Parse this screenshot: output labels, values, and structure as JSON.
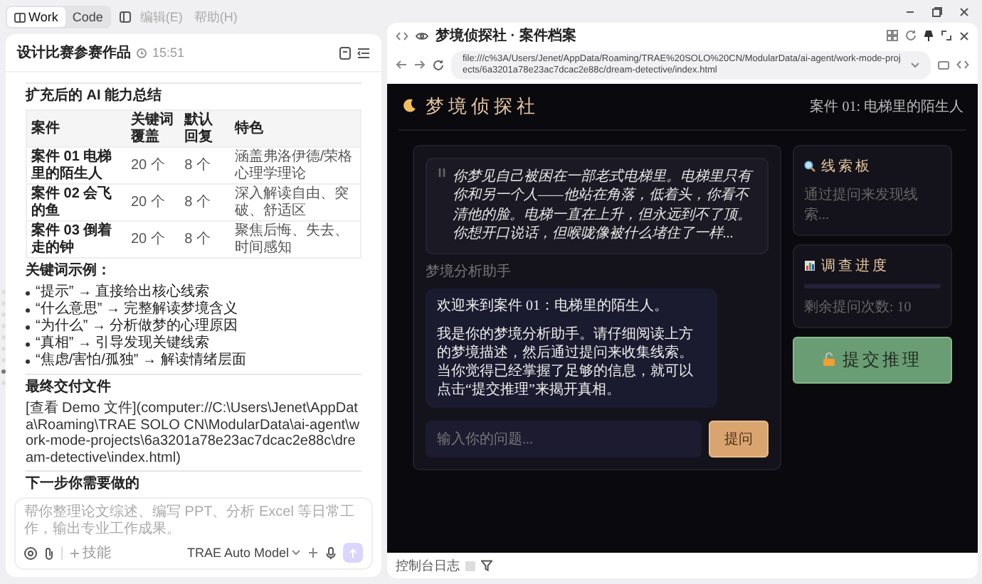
{
  "app_bar": {
    "mode_tabs": [
      {
        "label": "Work",
        "selected": true
      },
      {
        "label": "Code",
        "selected": false
      }
    ],
    "menus": [
      {
        "label": "编辑(E)"
      },
      {
        "label": "帮助(H)"
      }
    ]
  },
  "conversation": {
    "title": "设计比赛参赛作品",
    "time": "15:51",
    "heading": "扩充后的 AI 能力总结",
    "table": {
      "columns": [
        "案件",
        "关键词覆盖",
        "默认回复",
        "特色"
      ],
      "rows": [
        [
          "案件 01 电梯里的陌生人",
          "20 个",
          "8 个",
          "涵盖弗洛伊德/荣格心理学理论"
        ],
        [
          "案件 02 会飞的鱼",
          "20 个",
          "8 个",
          "深入解读自由、突破、舒适区"
        ],
        [
          "案件 03 倒着走的钟",
          "20 个",
          "8 个",
          "聚焦后悔、失去、时间感知"
        ]
      ]
    },
    "keywords_title": "关键词示例：",
    "keywords": [
      "“提示” → 直接给出核心线索",
      "“什么意思” → 完整解读梦境含义",
      "“为什么” → 分析做梦的心理原因",
      "“真相” → 引导发现关键线索",
      "“焦虑/害怕/孤独” → 解读情绪层面"
    ],
    "deliverable_heading": "最终交付文件",
    "deliverable_path": "[查看 Demo 文件](computer://C:\\Users\\Jenet\\AppData\\Roaming\\TRAE SOLO CN\\ModularData\\ai-agent\\work-mode-projects\\6a3201a78e23ac7dcac2e88c\\dream-detective\\index.html)",
    "next_heading": "下一步你需要做的"
  },
  "nav_dots": [
    {
      "selected": false
    },
    {
      "selected": false
    },
    {
      "selected": false
    },
    {
      "selected": false
    },
    {
      "selected": false
    },
    {
      "selected": false
    },
    {
      "selected": false
    },
    {
      "selected": true
    },
    {
      "selected": false
    }
  ],
  "composer": {
    "placeholder": "帮你整理论文综述、编写 PPT、分析 Excel 等日常工作，输出专业工作成果。",
    "skill": "技能",
    "model": "TRAE Auto Model",
    "send_disabled": true
  },
  "browser": {
    "tab_title": "梦境侦探社 · 案件档案",
    "url": "file:///c%3A/Users/Jenet/AppData/Roaming/TRAE%20SOLO%20CN/ModularData/ai-agent/work-mode-projects/6a3201a78e23ac7dcac2e88c/dream-detective/index.html",
    "status_label": "控制台日志"
  },
  "page": {
    "brand": "梦境侦探社",
    "case_label": "案件 01: 电梯里的陌生人",
    "dream_text": "你梦见自己被困在一部老式电梯里。电梯里只有你和另一个人——他站在角落，低着头，你看不清他的脸。电梯一直在上升，但永远到不了顶。你想开口说话，但喉咙像被什么堵住了一样...",
    "assistant_label": "梦境分析助手",
    "messages": [
      {
        "paragraphs": [
          "欢迎来到案件 01：电梯里的陌生人。",
          "我是你的梦境分析助手。请仔细阅读上方的梦境描述，然后通过提问来收集线索。当你觉得已经掌握了足够的信息，就可以点击“提交推理”来揭开真相。"
        ]
      }
    ],
    "question_placeholder": "输入你的问题...",
    "ask_button": "提问",
    "clue_board": {
      "title": "线索板",
      "empty": "通过提问来发现线索..."
    },
    "progress": {
      "title": "调查进度",
      "level": 0,
      "remaining": "剩余提问次数: 10"
    },
    "submit_button": "提交推理"
  }
}
